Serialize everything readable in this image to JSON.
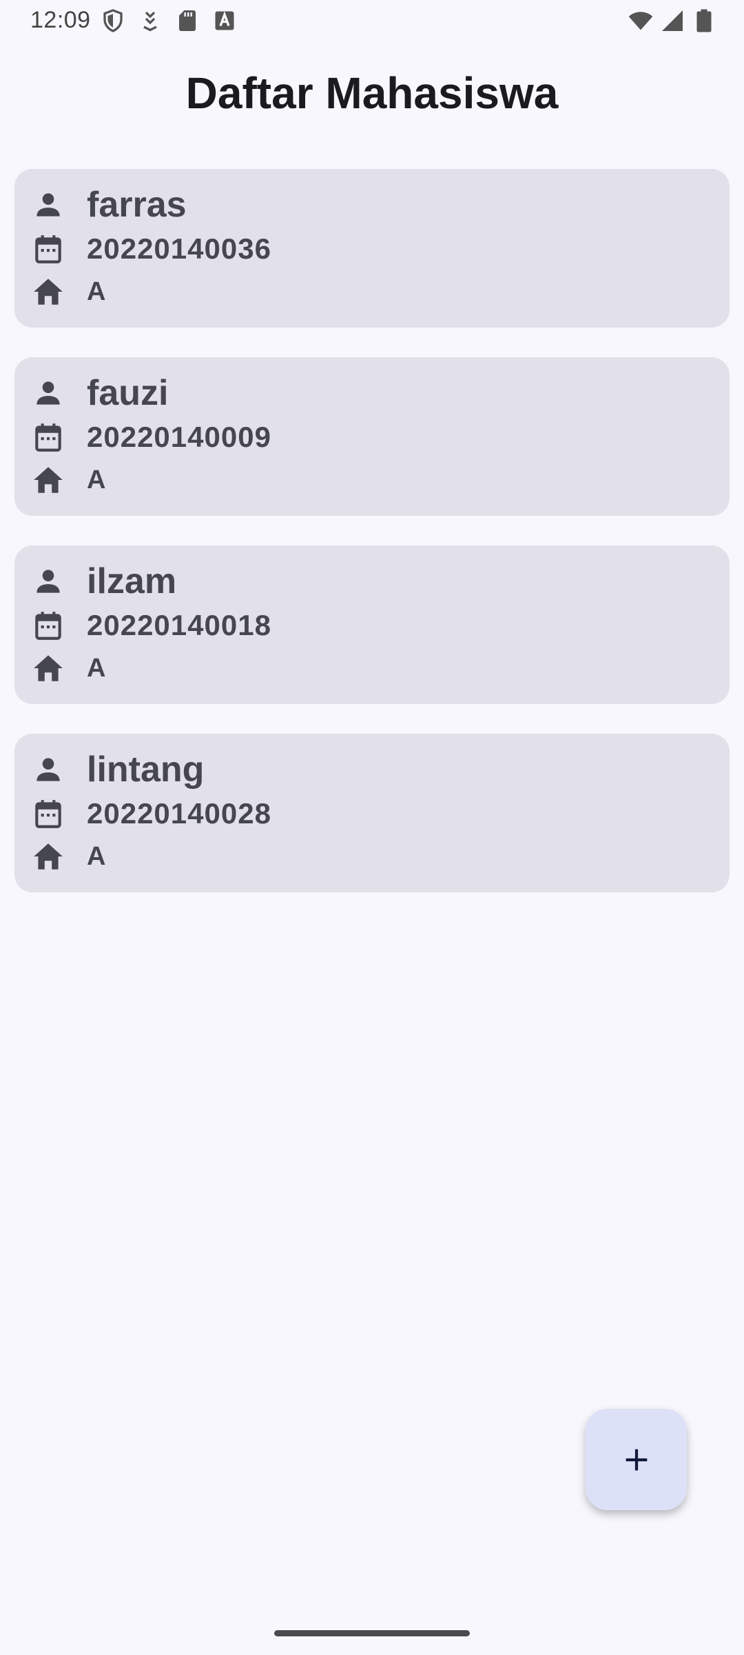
{
  "status_bar": {
    "time": "12:09",
    "left_icons": [
      "shield-icon",
      "download-icon",
      "sd-card-icon",
      "keyboard-a-icon"
    ],
    "right_icons": [
      "wifi-icon",
      "signal-icon",
      "battery-icon"
    ]
  },
  "header": {
    "title": "Daftar Mahasiswa"
  },
  "students": [
    {
      "name": "farras",
      "nim": "20220140036",
      "class": "A"
    },
    {
      "name": "fauzi",
      "nim": "20220140009",
      "class": "A"
    },
    {
      "name": "ilzam",
      "nim": "20220140018",
      "class": "A"
    },
    {
      "name": "lintang",
      "nim": "20220140028",
      "class": "A"
    }
  ],
  "row_icons": {
    "name": "person-icon",
    "nim": "calendar-icon",
    "class": "home-icon"
  },
  "fab": {
    "icon": "plus-icon"
  },
  "colors": {
    "background": "#f8f7fd",
    "card": "#e2e1ea",
    "text": "#45464f",
    "fab": "#dde1f8"
  }
}
